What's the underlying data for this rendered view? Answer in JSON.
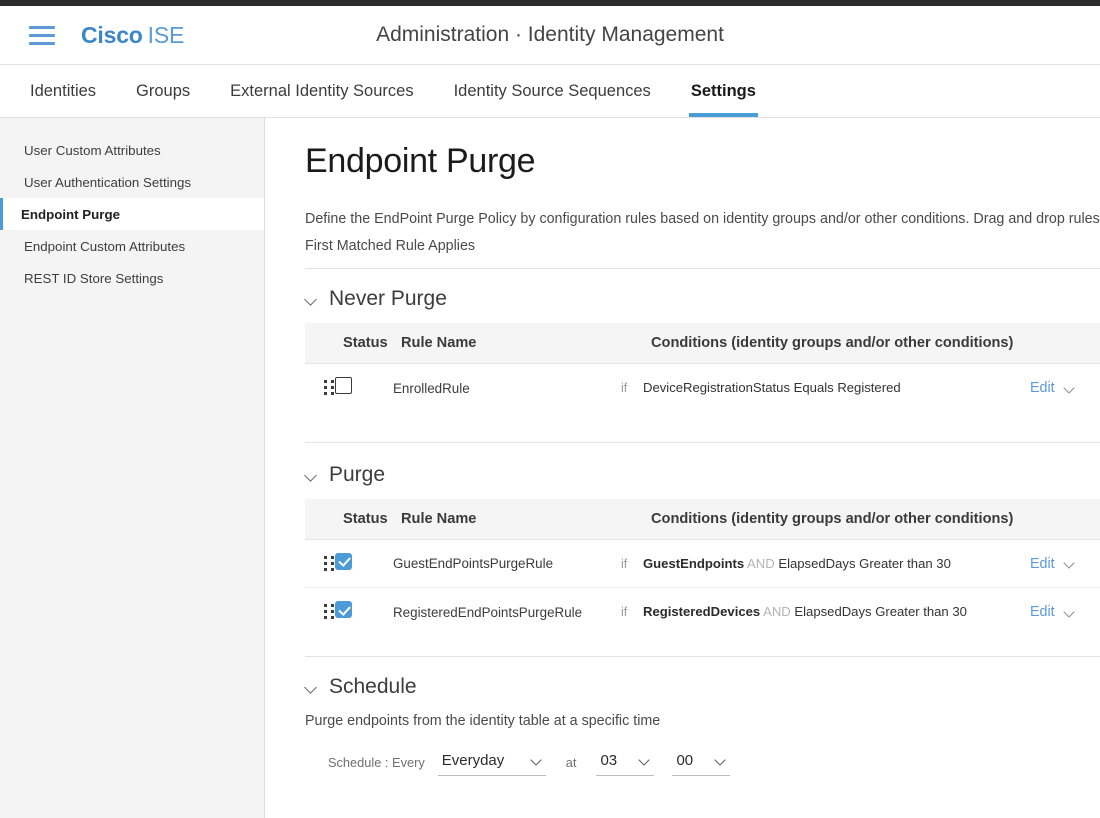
{
  "header": {
    "brand_primary": "Cisco",
    "brand_secondary": "ISE",
    "title": "Administration · Identity Management",
    "menu_icon": "hamburger-menu-icon"
  },
  "tabs": [
    {
      "label": "Identities",
      "active": false
    },
    {
      "label": "Groups",
      "active": false
    },
    {
      "label": "External Identity Sources",
      "active": false
    },
    {
      "label": "Identity Source Sequences",
      "active": false
    },
    {
      "label": "Settings",
      "active": true
    }
  ],
  "sidebar": {
    "items": [
      {
        "label": "User Custom Attributes",
        "active": false
      },
      {
        "label": "User Authentication Settings",
        "active": false
      },
      {
        "label": "Endpoint Purge",
        "active": true
      },
      {
        "label": "Endpoint Custom Attributes",
        "active": false
      },
      {
        "label": "REST ID Store Settings",
        "active": false
      }
    ]
  },
  "page": {
    "title": "Endpoint Purge",
    "description_line1": "Define the EndPoint Purge Policy by configuration rules based on identity groups and/or other conditions. Drag and drop rules to change the order.",
    "description_line2": "First Matched Rule Applies"
  },
  "table_headers": {
    "status": "Status",
    "rule_name": "Rule Name",
    "conditions": "Conditions (identity groups and/or other conditions)"
  },
  "sections": {
    "never_purge": {
      "title": "Never Purge",
      "rows": [
        {
          "checked": false,
          "rule_name": "EnrolledRule",
          "if_label": "if",
          "cond_bold": "",
          "cond_and": "",
          "cond_rest": "DeviceRegistrationStatus Equals Registered",
          "edit_label": "Edit"
        }
      ]
    },
    "purge": {
      "title": "Purge",
      "rows": [
        {
          "checked": true,
          "rule_name": "GuestEndPointsPurgeRule",
          "if_label": "if",
          "cond_bold": "GuestEndpoints",
          "cond_and": "AND",
          "cond_rest": "ElapsedDays Greater than 30",
          "edit_label": "Edit"
        },
        {
          "checked": true,
          "rule_name": "RegisteredEndPointsPurgeRule",
          "if_label": "if",
          "cond_bold": "RegisteredDevices",
          "cond_and": "AND",
          "cond_rest": "ElapsedDays Greater than 30",
          "edit_label": "Edit"
        }
      ]
    },
    "schedule": {
      "title": "Schedule",
      "subtitle": "Purge endpoints from the identity table at a specific time",
      "label": "Schedule : Every",
      "frequency_value": "Everyday",
      "at_label": "at",
      "hour_value": "03",
      "minute_value": "00"
    }
  },
  "colors": {
    "accent": "#4a9bd8",
    "link": "#5b9bd5",
    "brand": "#3a86c8"
  }
}
